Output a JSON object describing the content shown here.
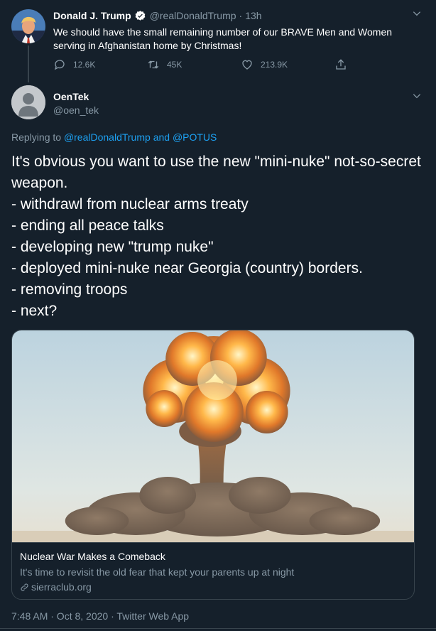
{
  "parent_tweet": {
    "display_name": "Donald J. Trump",
    "handle": "@realDonaldTrump",
    "separator": "·",
    "time": "13h",
    "text": "We should have the small remaining number of our BRAVE Men and Women serving in Afghanistan home by Christmas!",
    "replies": "12.6K",
    "retweets": "45K",
    "likes": "213.9K"
  },
  "main_tweet": {
    "display_name": "OenTek",
    "handle": "@oen_tek",
    "replying_prefix": "Replying to",
    "replying_mention_1": "@realDonaldTrump",
    "replying_and": "and",
    "replying_mention_2": "@POTUS",
    "text": "It's obvious you want to use the new \"mini-nuke\" not-so-secret weapon.\n- withdrawl from nuclear arms treaty\n- ending all peace talks\n- developing new \"trump nuke\"\n- deployed mini-nuke near Georgia (country) borders.\n- removing troops\n- next?",
    "timestamp": "7:48 AM · Oct 8, 2020 · Twitter Web App"
  },
  "link_card": {
    "title": "Nuclear War Makes a Comeback",
    "description": "It's time to revisit the old fear that kept your parents up at night",
    "domain": "sierraclub.org"
  },
  "colors": {
    "background": "#15202b",
    "secondary_text": "#8899a6",
    "accent": "#1da1f2",
    "border": "#38444d"
  },
  "icons": [
    "verified-badge-icon",
    "chevron-down-icon",
    "reply-icon",
    "retweet-icon",
    "like-icon",
    "share-icon",
    "link-icon"
  ]
}
